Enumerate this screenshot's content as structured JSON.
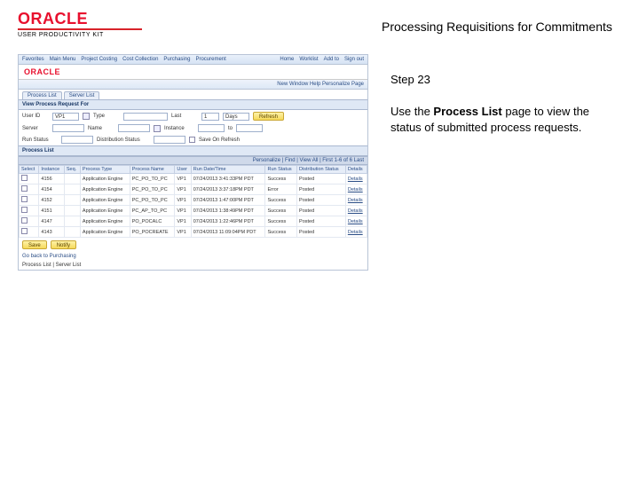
{
  "header": {
    "brand": "ORACLE",
    "sub_brand": "USER PRODUCTIVITY KIT",
    "doc_title": "Processing Requisitions for Commitments"
  },
  "instruction": {
    "step_label": "Step 23",
    "body_pre": "Use the ",
    "body_bold": "Process List",
    "body_post": " page to view the status of submitted process requests."
  },
  "app": {
    "topbar": {
      "items": [
        "Favorites",
        "Main Menu",
        "Project Costing",
        "Cost Collection",
        "Purchasing",
        "Procurement"
      ],
      "right": [
        "Home",
        "Worklist",
        "Add to",
        "Sign out"
      ]
    },
    "brand": "ORACLE",
    "subbar": "New Window  Help  Personalize Page",
    "tabs": {
      "tab1": "Process List",
      "tab2": "Server List"
    },
    "panel_title": "View Process Request For",
    "form": {
      "userid_label": "User ID",
      "userid_value": "VP1",
      "type_label": "Type",
      "type_value": "",
      "last_label": "Last",
      "last_value": "1",
      "last_unit": "Days",
      "refresh": "Refresh",
      "server_label": "Server",
      "name_label": "Name",
      "instance_label": "Instance",
      "to_label": "to",
      "runstatus_label": "Run Status",
      "diststatus_label": "Distribution Status",
      "save_on_refresh": "Save On Refresh"
    },
    "list_header": "Process List",
    "list_nav": "Personalize | Find | View All |  First 1-6 of 6 Last",
    "columns": [
      "Select",
      "Instance",
      "Seq.",
      "Process Type",
      "Process Name",
      "User",
      "Run Date/Time",
      "Run Status",
      "Distribution Status",
      "Details"
    ],
    "rows": [
      {
        "sel": "",
        "inst": "4156",
        "seq": "",
        "ptype": "Application Engine",
        "pname": "PC_PO_TO_PC",
        "user": "VP1",
        "dt": "07/24/2013 3:41:33PM PDT",
        "run": "Success",
        "dist": "Posted",
        "det": "Details"
      },
      {
        "sel": "",
        "inst": "4154",
        "seq": "",
        "ptype": "Application Engine",
        "pname": "PC_PO_TO_PC",
        "user": "VP1",
        "dt": "07/24/2013 3:37:18PM PDT",
        "run": "Error",
        "dist": "Posted",
        "det": "Details"
      },
      {
        "sel": "",
        "inst": "4152",
        "seq": "",
        "ptype": "Application Engine",
        "pname": "PC_PO_TO_PC",
        "user": "VP1",
        "dt": "07/24/2013 1:47:00PM PDT",
        "run": "Success",
        "dist": "Posted",
        "det": "Details"
      },
      {
        "sel": "",
        "inst": "4151",
        "seq": "",
        "ptype": "Application Engine",
        "pname": "PC_AP_TO_PC",
        "user": "VP1",
        "dt": "07/24/2013 1:38:49PM PDT",
        "run": "Success",
        "dist": "Posted",
        "det": "Details"
      },
      {
        "sel": "",
        "inst": "4147",
        "seq": "",
        "ptype": "Application Engine",
        "pname": "PO_POCALC",
        "user": "VP1",
        "dt": "07/24/2013 1:22:46PM PDT",
        "run": "Success",
        "dist": "Posted",
        "det": "Details"
      },
      {
        "sel": "",
        "inst": "4143",
        "seq": "",
        "ptype": "Application Engine",
        "pname": "PO_POCREATE",
        "user": "VP1",
        "dt": "07/24/2013 11:09:04PM PDT",
        "run": "Success",
        "dist": "Posted",
        "det": "Details"
      }
    ],
    "footer": {
      "save": "Save",
      "notify": "Notify",
      "back": "Go back to Purchasing",
      "tabs_footer": "Process List | Server List"
    }
  }
}
